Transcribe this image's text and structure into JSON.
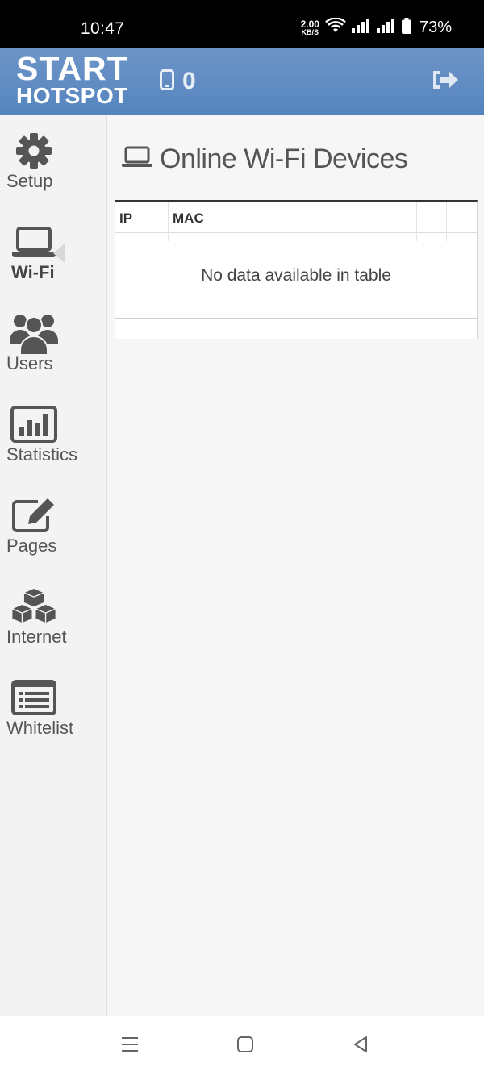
{
  "status_bar": {
    "time": "10:47",
    "net_speed_value": "2.00",
    "net_speed_unit": "KB/S",
    "battery": "73%"
  },
  "header": {
    "logo_line1": "START",
    "logo_line2": "HOTSPOT",
    "device_count": "0",
    "brand_color": "#5f8ec5"
  },
  "sidebar": {
    "items": [
      {
        "label": "Setup",
        "icon": "gear-icon"
      },
      {
        "label": "Wi-Fi",
        "icon": "laptop-icon",
        "active": true
      },
      {
        "label": "Users",
        "icon": "users-icon"
      },
      {
        "label": "Statistics",
        "icon": "bar-chart-icon"
      },
      {
        "label": "Pages",
        "icon": "edit-icon"
      },
      {
        "label": "Internet",
        "icon": "cubes-icon"
      },
      {
        "label": "Whitelist",
        "icon": "list-icon"
      }
    ]
  },
  "main": {
    "title": "Online Wi-Fi Devices",
    "table": {
      "columns": [
        "IP",
        "MAC",
        "",
        ""
      ],
      "empty_message": "No data available in table"
    }
  }
}
